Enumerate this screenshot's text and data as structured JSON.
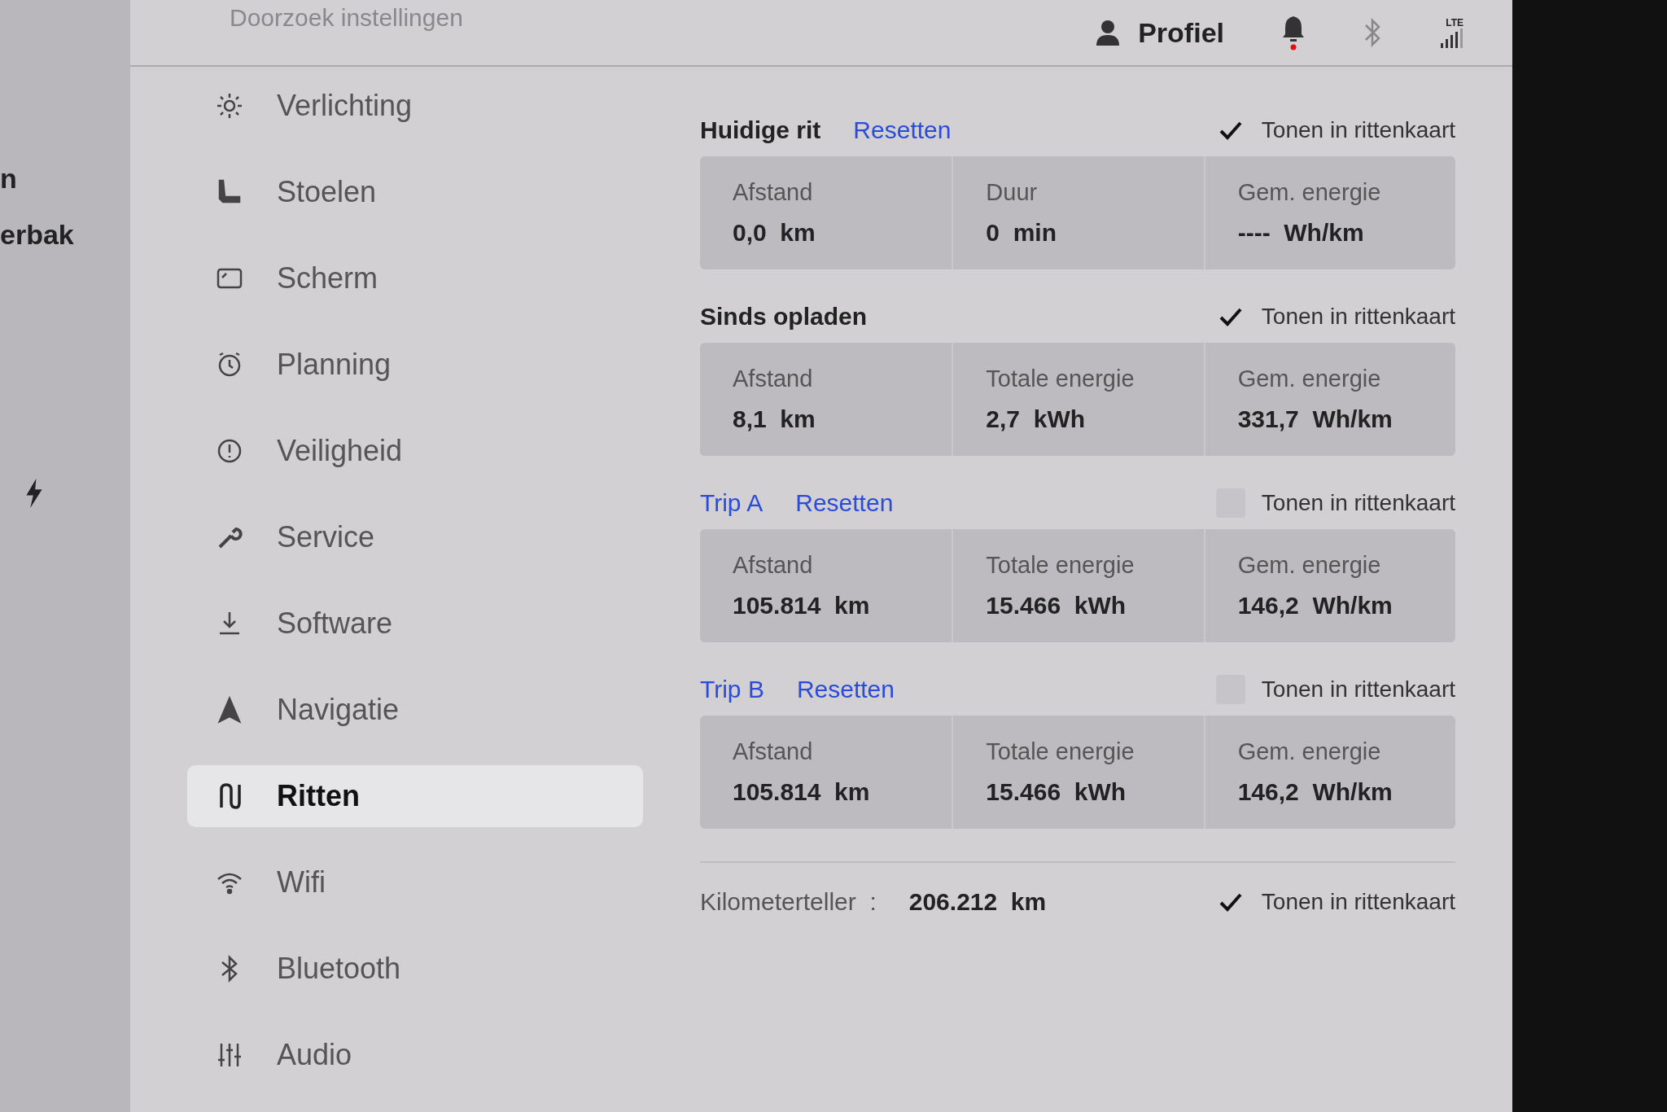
{
  "left_panel": {
    "texts": [
      "n",
      "erbak"
    ]
  },
  "search": {
    "placeholder": "Doorzoek instellingen"
  },
  "header": {
    "profile": "Profiel",
    "notification_dot": true,
    "lte": "LTE"
  },
  "sidebar": {
    "items": [
      {
        "label": "Verlichting",
        "selected": false
      },
      {
        "label": "Stoelen",
        "selected": false
      },
      {
        "label": "Scherm",
        "selected": false
      },
      {
        "label": "Planning",
        "selected": false
      },
      {
        "label": "Veiligheid",
        "selected": false
      },
      {
        "label": "Service",
        "selected": false
      },
      {
        "label": "Software",
        "selected": false
      },
      {
        "label": "Navigatie",
        "selected": false
      },
      {
        "label": "Ritten",
        "selected": true
      },
      {
        "label": "Wifi",
        "selected": false
      },
      {
        "label": "Bluetooth",
        "selected": false
      },
      {
        "label": "Audio",
        "selected": false
      }
    ]
  },
  "trips": [
    {
      "title": "Huidige rit",
      "title_link": false,
      "reset": "Resetten",
      "toggle": "Tonen in rittenkaart",
      "checked": true,
      "cells": [
        {
          "label": "Afstand",
          "value": "0,0  km"
        },
        {
          "label": "Duur",
          "value": "0  min"
        },
        {
          "label": "Gem. energie",
          "value": "----  Wh/km"
        }
      ]
    },
    {
      "title": "Sinds opladen",
      "title_link": false,
      "toggle": "Tonen in rittenkaart",
      "checked": true,
      "cells": [
        {
          "label": "Afstand",
          "value": "8,1  km"
        },
        {
          "label": "Totale energie",
          "value": "2,7  kWh"
        },
        {
          "label": "Gem. energie",
          "value": "331,7  Wh/km"
        }
      ]
    },
    {
      "title": "Trip A",
      "title_link": true,
      "reset": "Resetten",
      "toggle": "Tonen in rittenkaart",
      "checked": false,
      "cells": [
        {
          "label": "Afstand",
          "value": "105.814  km"
        },
        {
          "label": "Totale energie",
          "value": "15.466  kWh"
        },
        {
          "label": "Gem. energie",
          "value": "146,2  Wh/km"
        }
      ]
    },
    {
      "title": "Trip B",
      "title_link": true,
      "reset": "Resetten",
      "toggle": "Tonen in rittenkaart",
      "checked": false,
      "cells": [
        {
          "label": "Afstand",
          "value": "105.814  km"
        },
        {
          "label": "Totale energie",
          "value": "15.466  kWh"
        },
        {
          "label": "Gem. energie",
          "value": "146,2  Wh/km"
        }
      ]
    }
  ],
  "odometer": {
    "label": "Kilometerteller  :",
    "value": "206.212  km",
    "toggle": "Tonen in rittenkaart",
    "checked": true
  }
}
